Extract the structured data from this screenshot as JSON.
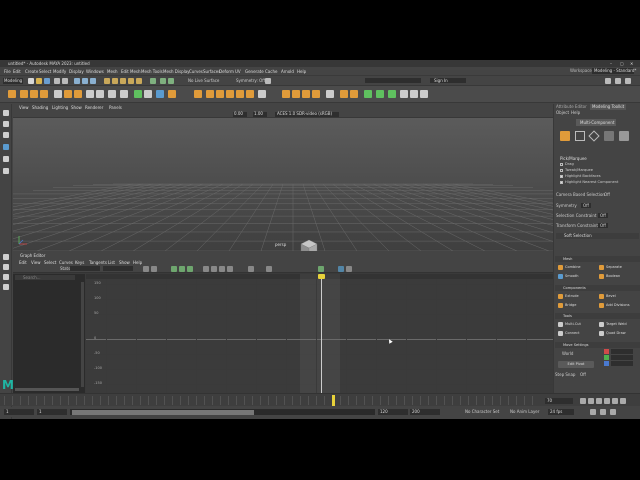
{
  "window": {
    "title": "untitled* - Autodesk MAYA 2023: untitled"
  },
  "menubar": {
    "items": [
      "File",
      "Edit",
      "Create",
      "Select",
      "Modify",
      "Display",
      "Windows",
      "Mesh",
      "Edit Mesh",
      "Mesh Tools",
      "Mesh Display",
      "Curves",
      "Surfaces",
      "Deform",
      "UV",
      "Generate",
      "Cache",
      "Arnold",
      "Help"
    ],
    "workspace_label": "Workspace :",
    "workspace_value": "Modeling - Standard*"
  },
  "statusline": {
    "mode": "Modeling",
    "live_surface": "No Live Surface",
    "symmetry": "Symmetry: Off",
    "signin": "Sign In"
  },
  "viewport": {
    "menu": [
      "View",
      "Shading",
      "Lighting",
      "Show",
      "Renderer",
      "Panels"
    ],
    "field1": "0.00",
    "field2": "1.00",
    "colorspace": "ACES 1.0 SDR-video (sRGB)",
    "camera_label": "persp"
  },
  "graph_editor": {
    "title": "Graph Editor",
    "menu": [
      "Edit",
      "View",
      "Select",
      "Curves",
      "Keys",
      "Tangents",
      "List",
      "Show",
      "Help"
    ],
    "stats_label": "Stats",
    "search_placeholder": "Search...",
    "y_ticks": [
      "150",
      "100",
      "50",
      "0",
      "-50",
      "-100",
      "-150"
    ]
  },
  "toolkit": {
    "tabs": [
      "Attribute Editor",
      "Modeling Toolkit"
    ],
    "object_label": "Object",
    "help_label": "Help",
    "multi_component": "Multi-Component",
    "pick_marquee": "Pick/Marquee",
    "options": [
      "Drag",
      "Tweak/Marquee",
      "Highlight Backfaces",
      "Highlight Nearest Component"
    ],
    "camera_based": "Camera Based Selection",
    "camera_based_value": "Off",
    "symmetry": "Symmetry",
    "symmetry_value": "Off",
    "selection_constraint": "Selection Constraint",
    "selection_constraint_value": "Off",
    "transform_constraint": "Transform Constraint",
    "transform_constraint_value": "Off",
    "soft_selection": "Soft Selection",
    "mesh_section": "Mesh",
    "mesh_tools": [
      "Combine",
      "Separate",
      "Smooth",
      "Boolean"
    ],
    "components_section": "Components",
    "component_tools": [
      "Extrude",
      "Bevel",
      "Bridge",
      "Add Divisions"
    ],
    "tools_section": "Tools",
    "tools": [
      "Multi-Cut",
      "Target Weld",
      "Connect",
      "Quad Draw"
    ],
    "move_settings": "Move Settings",
    "world_label": "World",
    "edit_pivot": "Edit Pivot",
    "step_snap": "Step Snap",
    "step_snap_value": "Off"
  },
  "timeslider": {
    "start": "1",
    "start2": "1",
    "playback_start": "120",
    "playback_end": "200",
    "current_frame": "70",
    "character_set": "No Character Set",
    "anim_layer": "No Anim Layer",
    "fps": "24 fps"
  },
  "logo": "M",
  "colors": {
    "app_bg": "#444444",
    "accent_blue": "#5285a6",
    "maya_teal": "#1fb5a3",
    "timeline_yellow": "#e8d23a"
  }
}
